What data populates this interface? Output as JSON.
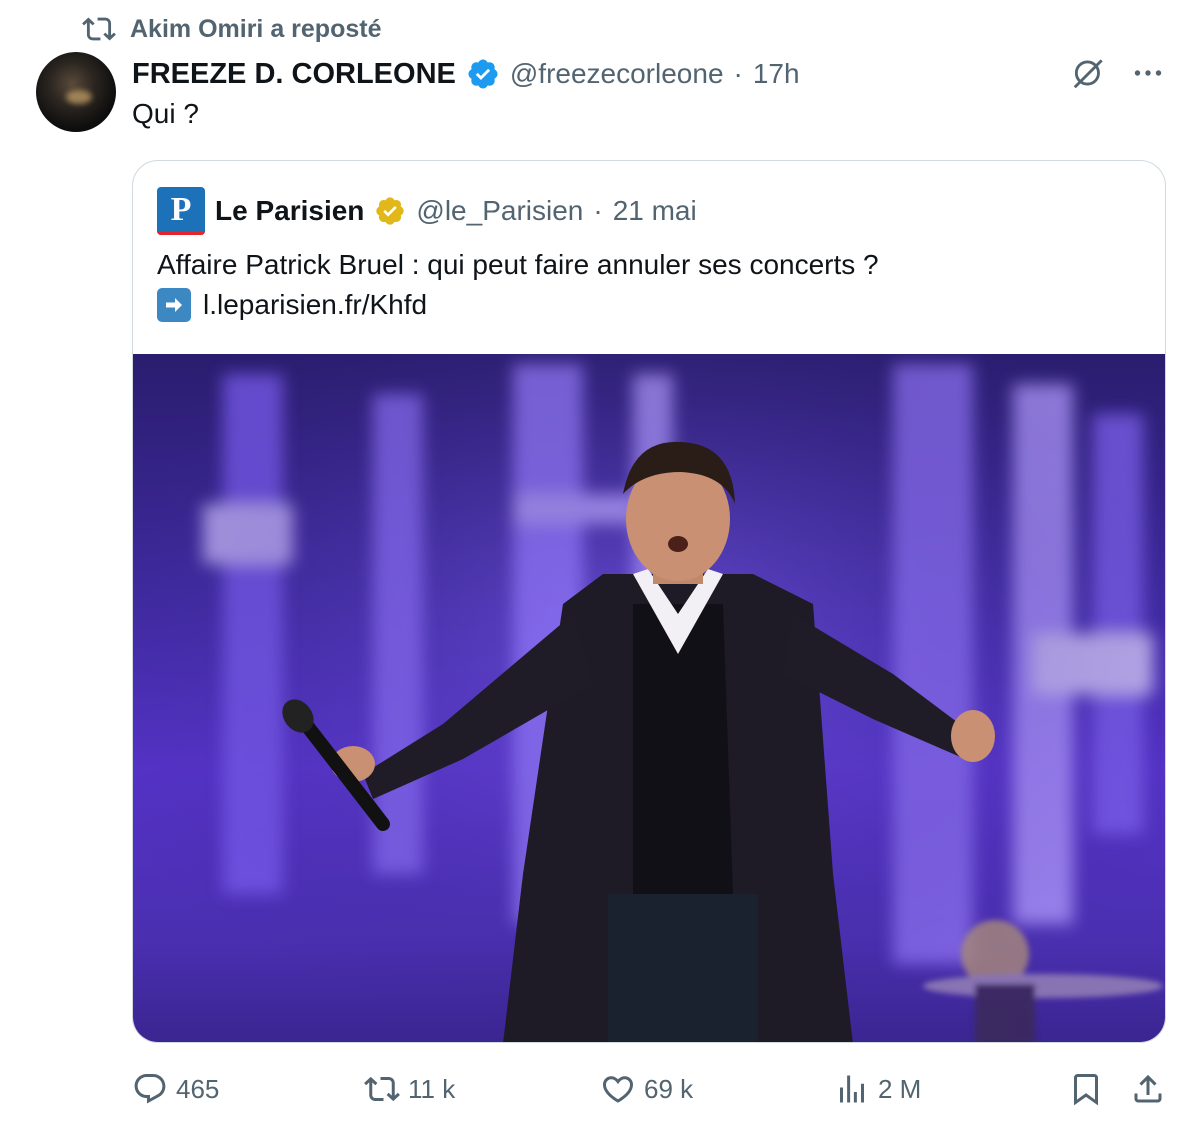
{
  "repost": {
    "icon": "repost-icon",
    "text": "Akim Omiri a reposté"
  },
  "author": {
    "display_name": "FREEZE D. CORLEONE",
    "handle": "@freezecorleone",
    "separator": "·",
    "time": "17h",
    "verified_color": "#1d9bf0"
  },
  "tweet": {
    "text": "Qui ?"
  },
  "quote": {
    "display_name": "Le Parisien",
    "logo_letter": "P",
    "handle": "@le_Parisien",
    "separator": "·",
    "time": "21 mai",
    "verified_color": "#e2b719",
    "text": "Affaire Patrick Bruel : qui peut faire annuler ses concerts ?",
    "link": "l.leparisien.fr/Khfd",
    "link_icon": "right-arrow-emoji"
  },
  "actions": {
    "replies": "465",
    "reposts": "11 k",
    "likes": "69 k",
    "views": "2 M"
  },
  "colors": {
    "secondary_text": "#536471",
    "border": "#cfd9de",
    "verified_blue": "#1d9bf0",
    "verified_gold": "#e2b719"
  }
}
